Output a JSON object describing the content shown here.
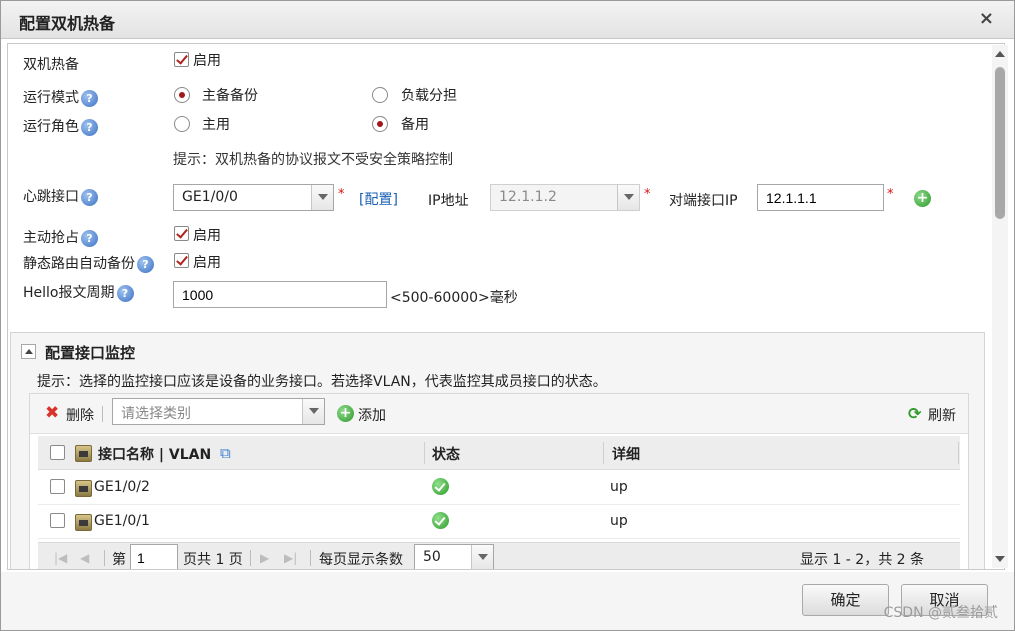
{
  "dialog": {
    "title": "配置双机热备",
    "close": "×"
  },
  "form": {
    "ha": {
      "label": "双机热备",
      "enable_label": "启用",
      "enabled": true
    },
    "run_mode": {
      "label": "运行模式",
      "options": [
        "主备备份",
        "负载分担"
      ],
      "selected": "主备备份"
    },
    "run_role": {
      "label": "运行角色",
      "options": [
        "主用",
        "备用"
      ],
      "selected": "备用"
    },
    "hint": "提示：双机热备的协议报文不受安全策略控制",
    "heartbeat": {
      "label": "心跳接口",
      "interface": "GE1/0/0",
      "config_link": "[配置]",
      "ip_label": "IP地址",
      "ip_value": "12.1.1.2",
      "peer_label": "对端接口IP",
      "peer_value": "12.1.1.1",
      "required_mark": "*"
    },
    "preempt": {
      "label": "主动抢占",
      "enable_label": "启用",
      "enabled": true
    },
    "static_route_backup": {
      "label": "静态路由自动备份",
      "enable_label": "启用",
      "enabled": true
    },
    "hello": {
      "label": "Hello报文周期",
      "value": "1000",
      "range": "<500-60000>毫秒"
    },
    "help_glyph": "?"
  },
  "monitor": {
    "title": "配置接口监控",
    "hint": "提示：选择的监控接口应该是设备的业务接口。若选择VLAN，代表监控其成员接口的状态。",
    "toolbar": {
      "delete_label": "删除",
      "category_placeholder": "请选择类别",
      "add_label": "添加",
      "refresh_label": "刷新"
    },
    "columns": [
      "接口名称 | VLAN",
      "状态",
      "详细"
    ],
    "rows": [
      {
        "name": "GE1/0/2",
        "status": "ok",
        "detail": "up"
      },
      {
        "name": "GE1/0/1",
        "status": "ok",
        "detail": "up"
      }
    ],
    "pager": {
      "page_prefix": "第",
      "page": "1",
      "page_suffix": "页共 1 页",
      "per_page_label": "每页显示条数",
      "per_page": "50",
      "summary": "显示 1 - 2，共 2 条"
    }
  },
  "footer": {
    "ok_label": "确定",
    "cancel_label": "取消",
    "watermark": "CSDN @贰叁拾贰"
  },
  "colors": {
    "accent_red": "#a0181b",
    "link_blue": "#1a5fb4",
    "ok_green": "#2f9b2c"
  }
}
